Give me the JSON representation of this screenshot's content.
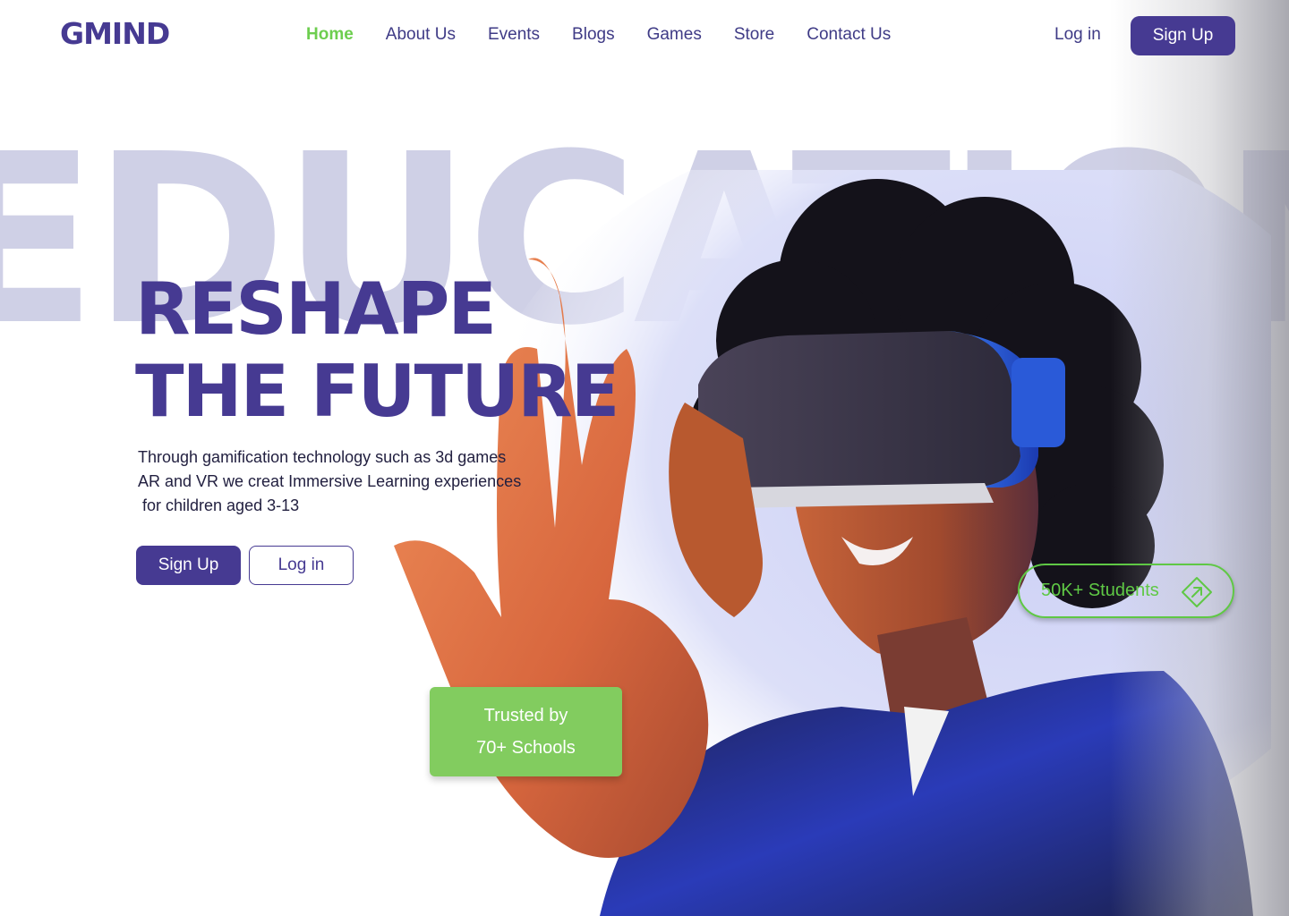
{
  "brand": {
    "logo": "GMIND"
  },
  "nav": {
    "links": [
      {
        "label": "Home",
        "active": true
      },
      {
        "label": "About Us"
      },
      {
        "label": "Events"
      },
      {
        "label": "Blogs"
      },
      {
        "label": "Games"
      },
      {
        "label": "Store"
      },
      {
        "label": "Contact Us"
      }
    ],
    "login_label": "Log in",
    "signup_label": "Sign Up"
  },
  "hero": {
    "background_word": "EDUCATION",
    "headline_line1": "RESHAPE",
    "headline_line2": "THE FUTURE",
    "description_lines": [
      "Through gamification technology such as 3d games",
      "AR and VR we creat Immersive Learning experiences",
      " for children aged 3-13"
    ],
    "signup_label": "Sign Up",
    "login_label": "Log in",
    "students_badge": "50K+ Students",
    "trusted_line1": "Trusted by",
    "trusted_line2": "70+ Schools"
  },
  "icons": {
    "students_badge_icon": "arrow-up-right-diamond-icon",
    "hero_image": "vr-headset-photo"
  },
  "colors": {
    "primary": "#463a92",
    "accent_green": "#6dce4f",
    "trusted_bg": "#82cc5f",
    "bg_word": "#cfd0e6"
  }
}
